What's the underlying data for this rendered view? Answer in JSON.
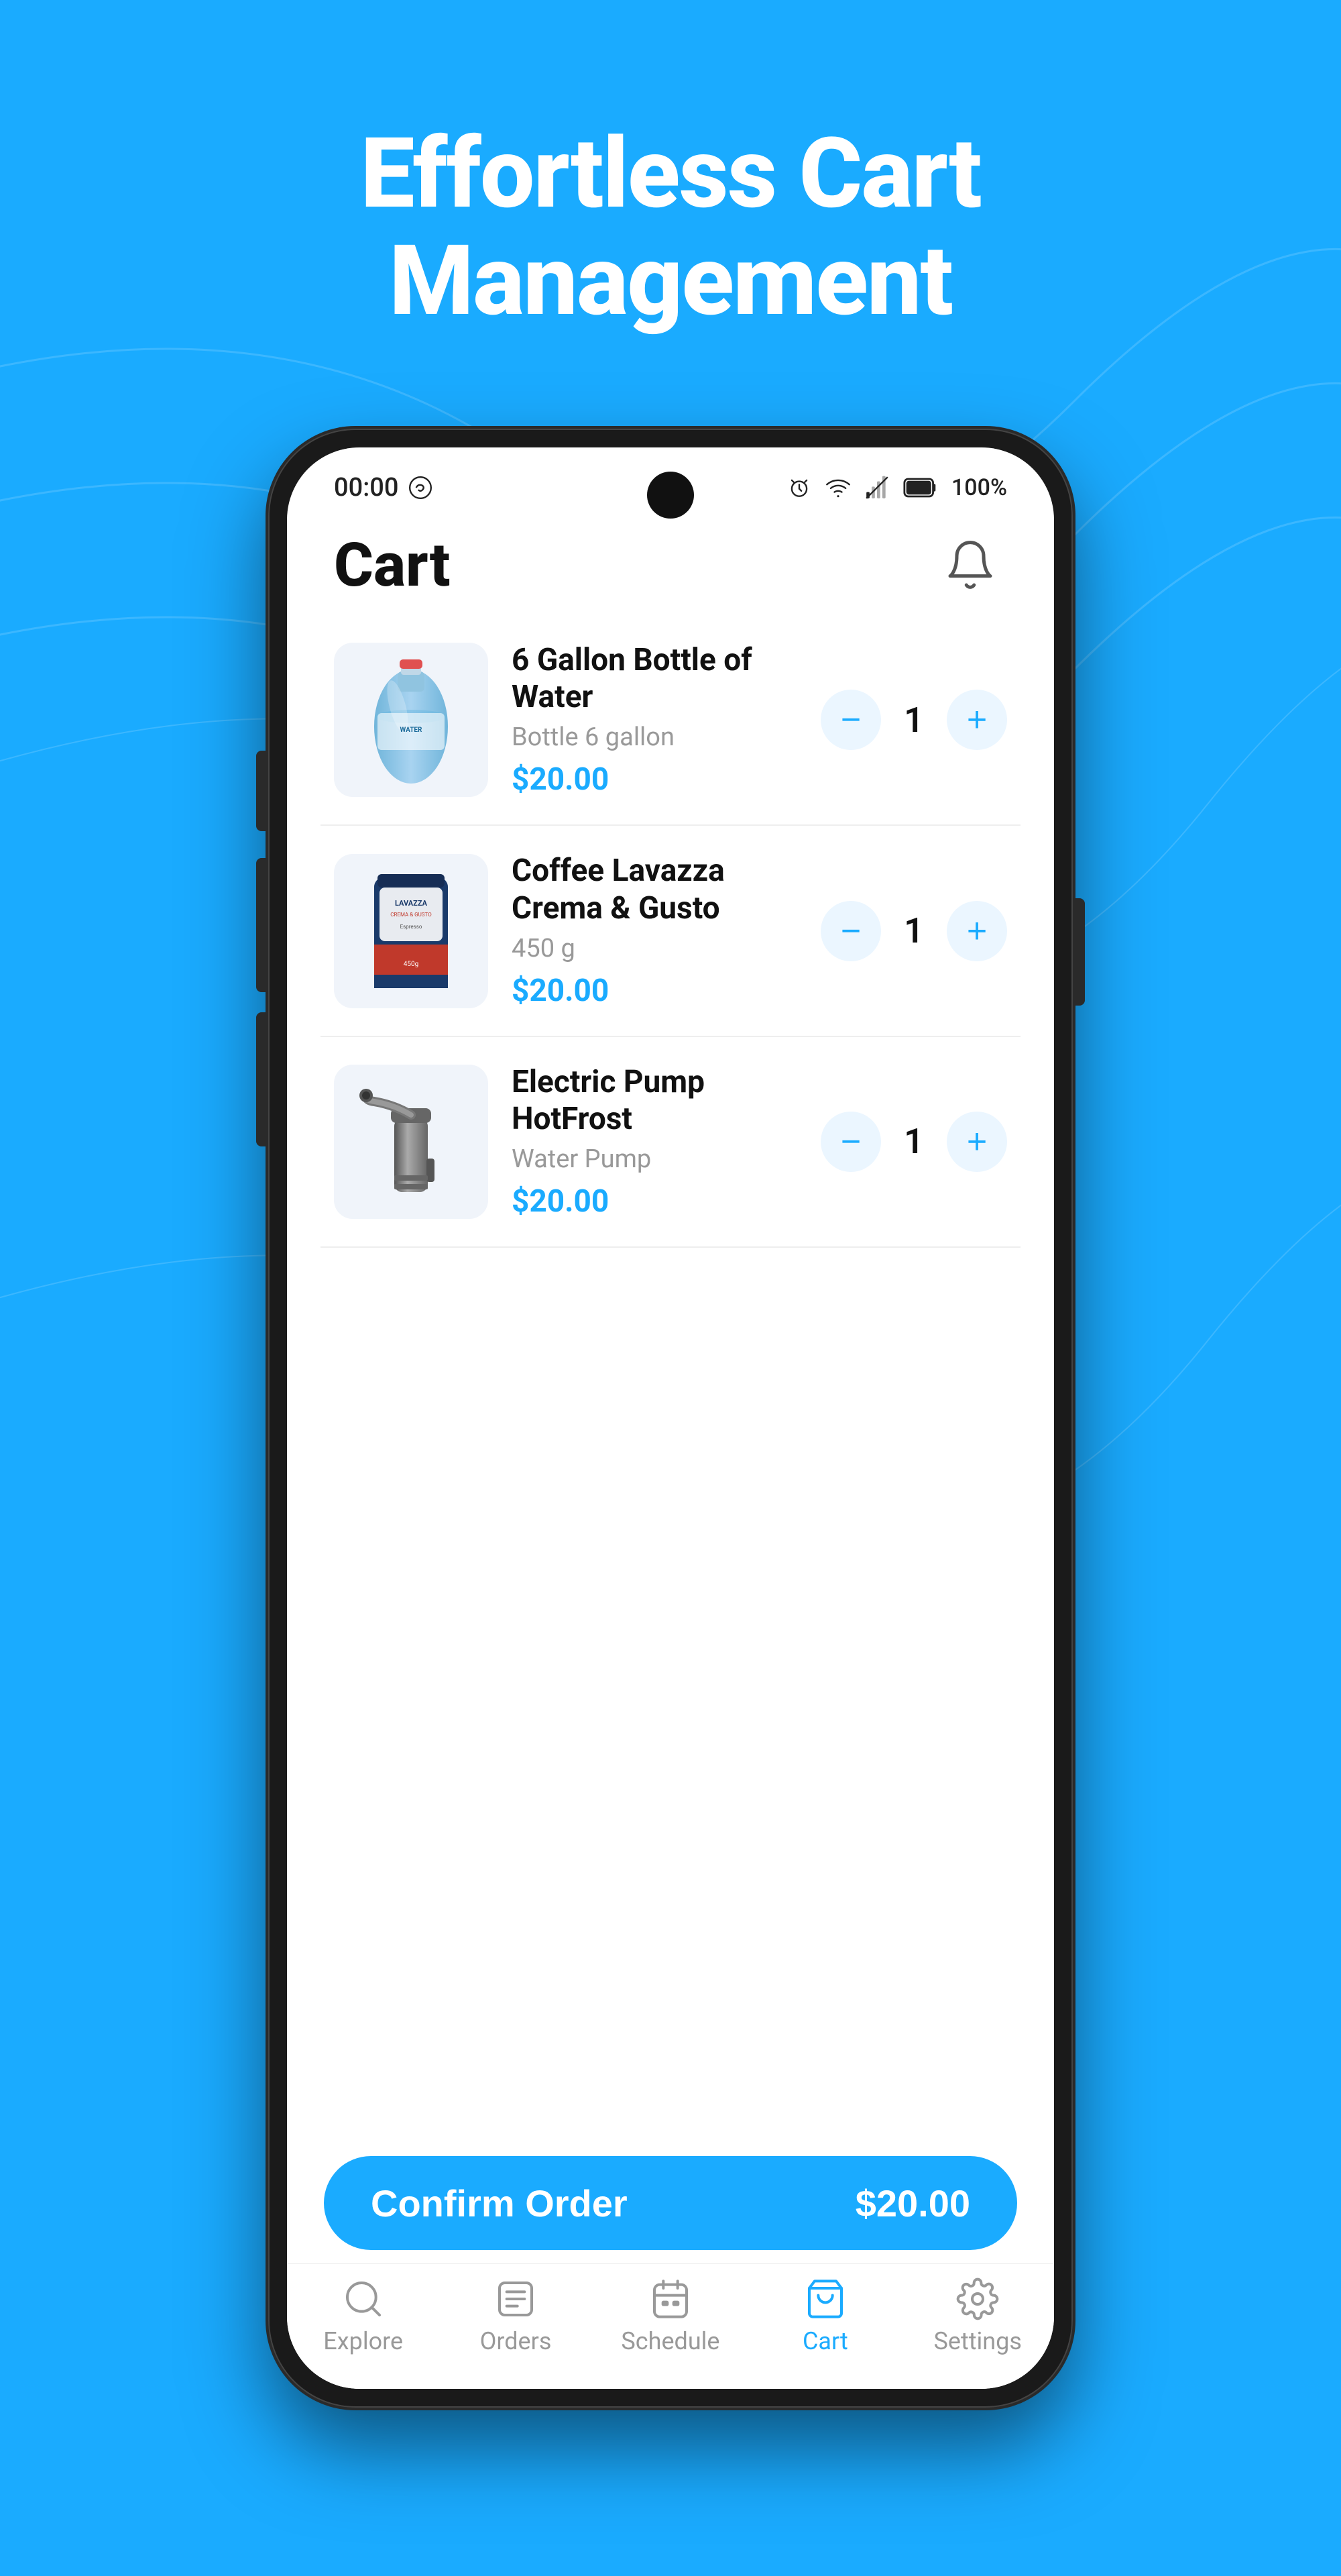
{
  "hero": {
    "title_line1": "Effortless Cart",
    "title_line2": "Management"
  },
  "status_bar": {
    "time": "00:00",
    "battery": "100%"
  },
  "app_header": {
    "title": "Cart"
  },
  "cart_items": [
    {
      "id": "item-1",
      "name": "6 Gallon Bottle of Water",
      "subtitle": "Bottle 6 gallon",
      "price": "$20.00",
      "quantity": "1",
      "image_type": "water-bottle"
    },
    {
      "id": "item-2",
      "name": "Coffee Lavazza Crema & Gusto",
      "subtitle": "450 g",
      "price": "$20.00",
      "quantity": "1",
      "image_type": "coffee"
    },
    {
      "id": "item-3",
      "name": "Electric Pump HotFrost",
      "subtitle": "Water Pump",
      "price": "$20.00",
      "quantity": "1",
      "image_type": "pump"
    }
  ],
  "confirm_button": {
    "label": "Confirm Order",
    "price": "$20.00"
  },
  "bottom_nav": [
    {
      "id": "explore",
      "label": "Explore",
      "active": false
    },
    {
      "id": "orders",
      "label": "Orders",
      "active": false
    },
    {
      "id": "schedule",
      "label": "Schedule",
      "active": false
    },
    {
      "id": "cart",
      "label": "Cart",
      "active": true
    },
    {
      "id": "settings",
      "label": "Settings",
      "active": false
    }
  ]
}
